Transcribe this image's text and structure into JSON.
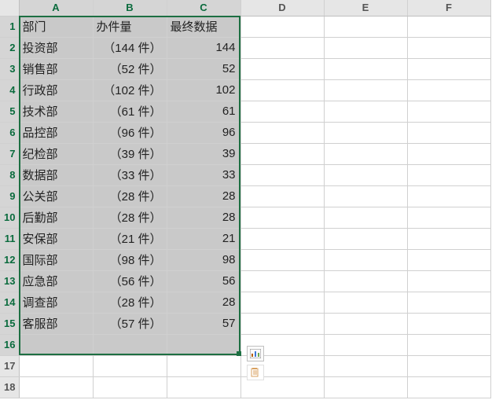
{
  "columns": [
    "A",
    "B",
    "C",
    "D",
    "E",
    "F"
  ],
  "headers": {
    "a": "部门",
    "b": "办件量",
    "c": "最终数据"
  },
  "rows": [
    {
      "a": "投资部",
      "b": "（144 件）",
      "c": "144"
    },
    {
      "a": "销售部",
      "b": "（52 件）",
      "c": "52"
    },
    {
      "a": "行政部",
      "b": "（102 件）",
      "c": "102"
    },
    {
      "a": "技术部",
      "b": "（61 件）",
      "c": "61"
    },
    {
      "a": "品控部",
      "b": "（96 件）",
      "c": "96"
    },
    {
      "a": "纪检部",
      "b": "（39 件）",
      "c": "39"
    },
    {
      "a": "数据部",
      "b": "（33 件）",
      "c": "33"
    },
    {
      "a": "公关部",
      "b": "（28 件）",
      "c": "28"
    },
    {
      "a": "后勤部",
      "b": "（28 件）",
      "c": "28"
    },
    {
      "a": "安保部",
      "b": "（21 件）",
      "c": "21"
    },
    {
      "a": "国际部",
      "b": "（98 件）",
      "c": "98"
    },
    {
      "a": "应急部",
      "b": "（56 件）",
      "c": "56"
    },
    {
      "a": "调查部",
      "b": "（28 件）",
      "c": "28"
    },
    {
      "a": "客服部",
      "b": "（57 件）",
      "c": "57"
    }
  ],
  "chart_data": {
    "type": "table",
    "title": "",
    "columns": [
      "部门",
      "办件量",
      "最终数据"
    ],
    "data": [
      [
        "投资部",
        "（144 件）",
        144
      ],
      [
        "销售部",
        "（52 件）",
        52
      ],
      [
        "行政部",
        "（102 件）",
        102
      ],
      [
        "技术部",
        "（61 件）",
        61
      ],
      [
        "品控部",
        "（96 件）",
        96
      ],
      [
        "纪检部",
        "（39 件）",
        39
      ],
      [
        "数据部",
        "（33 件）",
        33
      ],
      [
        "公关部",
        "（28 件）",
        28
      ],
      [
        "后勤部",
        "（28 件）",
        28
      ],
      [
        "安保部",
        "（21 件）",
        21
      ],
      [
        "国际部",
        "（98 件）",
        98
      ],
      [
        "应急部",
        "（56 件）",
        56
      ],
      [
        "调查部",
        "（28 件）",
        28
      ],
      [
        "客服部",
        "（57 件）",
        57
      ]
    ]
  }
}
